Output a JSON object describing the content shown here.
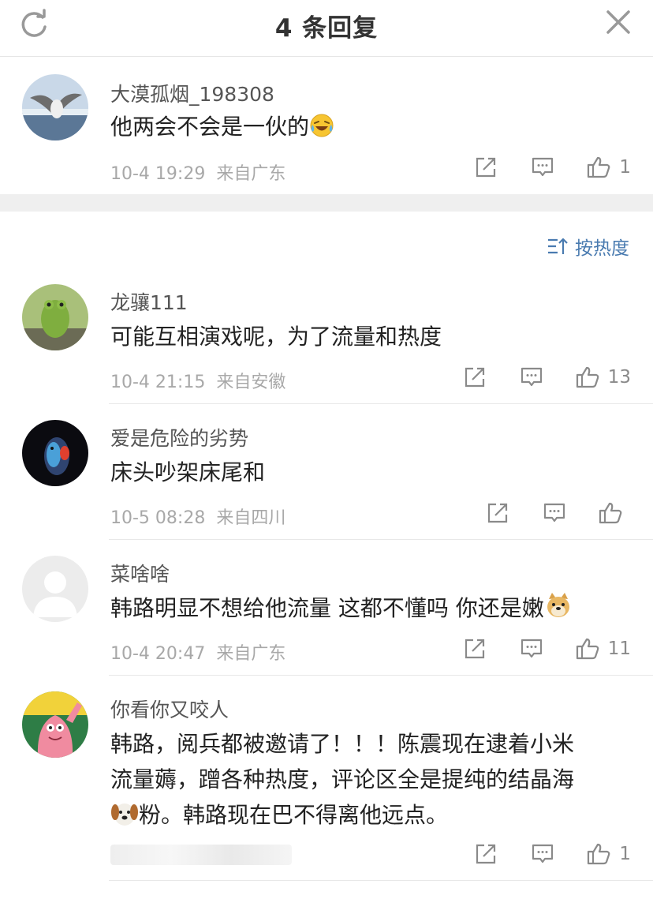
{
  "header": {
    "title": "4 条回复",
    "refresh_icon": "refresh-icon",
    "close_icon": "close-icon"
  },
  "original_comment": {
    "username": "大漠孤烟_198308",
    "text": "他两会不会是一伙的",
    "emoji": "laughing-crying-emoji",
    "time": "10-4 19:29",
    "location": "来自广东",
    "likes": "1"
  },
  "sort": {
    "label": "按热度",
    "icon": "sort-icon"
  },
  "replies": [
    {
      "username": "龙骧111",
      "text": "可能互相演戏呢，为了流量和热度",
      "time": "10-4 21:15",
      "location": "来自安徽",
      "likes": "13"
    },
    {
      "username": "爱是危险的劣势",
      "text": "床头吵架床尾和",
      "time": "10-5 08:28",
      "location": "来自四川",
      "likes": ""
    },
    {
      "username": "菜啥啥",
      "text": "韩路明显不想给他流量 这都不懂吗 你还是嫩",
      "emoji": "doge-emoji",
      "time": "10-4 20:47",
      "location": "来自广东",
      "likes": "11"
    },
    {
      "username": "你看你又咬人",
      "text_line1": "韩路，阅兵都被邀请了！！！陈震现在逮着小米",
      "text_line2": "流量薅，蹭各种热度，评论区全是提纯的结晶海",
      "text_line3": "粉。韩路现在巴不得离他远点。",
      "emoji": "dog-emoji",
      "likes": "1"
    }
  ],
  "colors": {
    "accent": "#4a7bb0",
    "meta_gray": "#a8a8a8",
    "divider": "#e8e8e8",
    "gap_bg": "#efefef"
  }
}
